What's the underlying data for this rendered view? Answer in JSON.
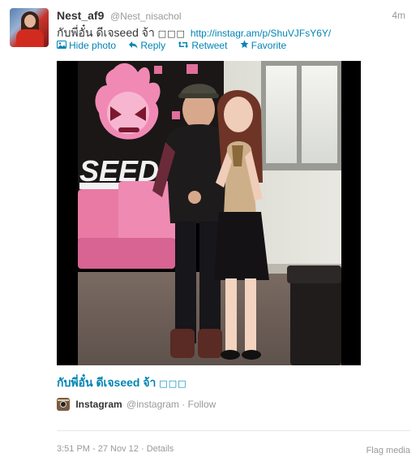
{
  "tweet": {
    "fullname": "Nest_af9",
    "username": "@Nest_nisachol",
    "time": "4m",
    "text": "กับพี่อั๋น ดีเจseed จ้า",
    "text_boxes": "□□□",
    "link": "http://instagr.am/p/ShuVJFsY6Y/"
  },
  "actions": {
    "hide_photo": "Hide photo",
    "reply": "Reply",
    "retweet": "Retweet",
    "favorite": "Favorite"
  },
  "media": {
    "caption": "กับพี่อั๋น ดีเจseed จ้า",
    "caption_boxes": "□□□",
    "source_name": "Instagram",
    "source_user": "@instagram",
    "separator": "·",
    "follow": "Follow"
  },
  "footer": {
    "timestamp": "3:51 PM - 27 Nov 12",
    "separator": "·",
    "details": "Details",
    "flag_media": "Flag media"
  },
  "icons": {
    "hide_photo": "photo-icon",
    "reply": "reply-icon",
    "retweet": "retweet-icon",
    "favorite": "star-icon"
  },
  "colors": {
    "link": "#0084b4",
    "muted": "#999999",
    "text": "#333333"
  }
}
